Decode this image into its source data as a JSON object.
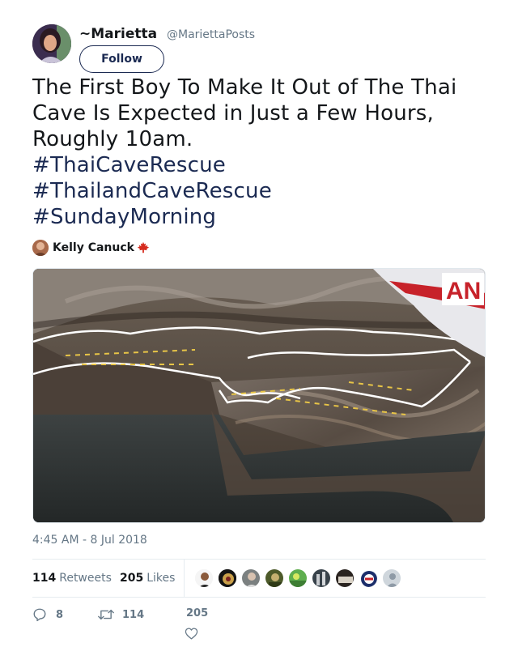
{
  "author": {
    "display_name": "~Marietta",
    "handle": "@MariettaPosts",
    "follow_label": "Follow"
  },
  "tweet": {
    "lines": [
      "The First Boy To Make It Out of The Thai",
      "Cave Is Expected in Just a Few Hours,",
      "Roughly 10am."
    ],
    "hashtags": [
      "#ThaiCaveRescue",
      "#ThailandCaveRescue",
      "#SundayMorning"
    ]
  },
  "media_credit": {
    "name": "Kelly Canuck"
  },
  "media": {
    "channel_logo_text": "AN"
  },
  "timestamp": "4:45 AM - 8 Jul 2018",
  "stats": {
    "retweets_count": "114",
    "retweets_label": "Retweets",
    "likes_count": "205",
    "likes_label": "Likes"
  },
  "actions": {
    "reply_count": "8",
    "retweet_count": "114",
    "like_count": "205"
  },
  "icons": {
    "reply": "reply-icon",
    "retweet": "retweet-icon",
    "like": "heart-icon",
    "credit_flag": "maple-leaf-icon"
  },
  "colors": {
    "hashtag": "#1b2a52",
    "muted": "#657786",
    "text": "#14171a"
  }
}
